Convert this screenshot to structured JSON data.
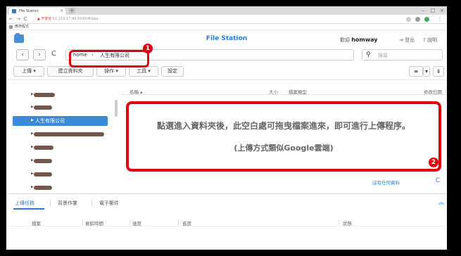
{
  "browser": {
    "tab_title": "File Station",
    "url_warning": "▲ 不安全",
    "url_text": "61.219.17.46:5000/#/app",
    "bookmark_label": "應用程式"
  },
  "header": {
    "app_title": "File Station",
    "welcome_prefix": "歡迎",
    "username": "homway",
    "logout_label": "登出",
    "help_label": "說明"
  },
  "path": {
    "crumbs": [
      "home",
      "人生有限公司"
    ],
    "separator": "›",
    "search_placeholder": "搜尋"
  },
  "toolbar": {
    "upload_label": "上傳",
    "new_folder_label": "建立資料夾",
    "action_label": "操作",
    "tools_label": "工具",
    "settings_label": "設定"
  },
  "tree": {
    "selected_label": "人生有限公司"
  },
  "list": {
    "col_name": "名稱",
    "col_size": "大小",
    "col_type": "檔案類型",
    "col_modified": "修改日期",
    "empty_text": "沒有任何資料"
  },
  "callout": {
    "line1": "點選進入資料夾後，此空白處可拖曳檔案進來，即可進行上傳程序。",
    "line2": "(上傳方式類似Google雲端)",
    "badge1": "1",
    "badge2": "2"
  },
  "bottom": {
    "tabs": [
      "上傳任務",
      "背景作業",
      "電子郵件"
    ],
    "cols": [
      "檔案",
      "剩餘時間",
      "速度",
      "進度",
      "狀態"
    ]
  },
  "colors": {
    "accent": "#2b7bd1",
    "selection": "#3a8ad8",
    "annotation": "#e3000b"
  }
}
